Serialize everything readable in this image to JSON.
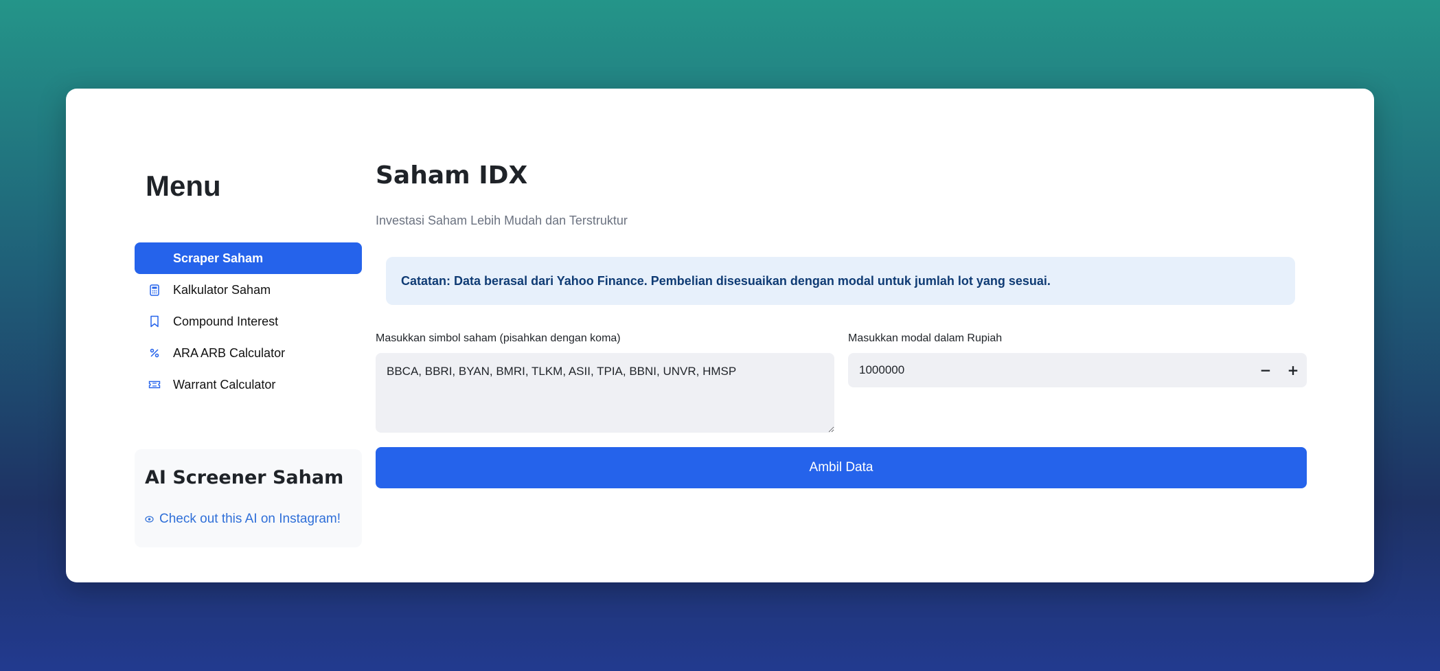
{
  "sidebar": {
    "title": "Menu",
    "items": [
      {
        "label": "Scraper Saham",
        "icon": "chart-icon",
        "active": true
      },
      {
        "label": "Kalkulator Saham",
        "icon": "calculator-icon",
        "active": false
      },
      {
        "label": "Compound Interest",
        "icon": "bookmark-icon",
        "active": false
      },
      {
        "label": "ARA ARB Calculator",
        "icon": "percent-icon",
        "active": false
      },
      {
        "label": "Warrant Calculator",
        "icon": "ticket-icon",
        "active": false
      }
    ],
    "promo": {
      "title": "AI Screener Saham",
      "link_text": "Check out this AI on Instagram!",
      "link_icon": "eye-icon"
    }
  },
  "main": {
    "title": "Saham IDX",
    "subtitle": "Investasi Saham Lebih Mudah dan Terstruktur",
    "info": "Catatan: Data berasal dari Yahoo Finance. Pembelian disesuaikan dengan modal untuk jumlah lot yang sesuai.",
    "symbols": {
      "label": "Masukkan simbol saham (pisahkan dengan koma)",
      "value": "BBCA, BBRI, BYAN, BMRI, TLKM, ASII, TPIA, BBNI, UNVR, HMSP"
    },
    "capital": {
      "label": "Masukkan modal dalam Rupiah",
      "value": "1000000",
      "minus": "−",
      "plus": "+"
    },
    "submit_label": "Ambil Data"
  },
  "colors": {
    "accent": "#2563eb",
    "info_bg": "#e7f0fb",
    "info_text": "#0f3b74",
    "input_bg": "#eff0f4"
  }
}
